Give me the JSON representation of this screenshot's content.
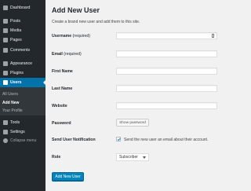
{
  "sidebar": {
    "items": [
      {
        "label": "Dashboard",
        "icon": "dashboard-icon"
      },
      {
        "label": "Posts",
        "icon": "pin-icon"
      },
      {
        "label": "Media",
        "icon": "media-icon"
      },
      {
        "label": "Pages",
        "icon": "page-icon"
      },
      {
        "label": "Comments",
        "icon": "comment-icon"
      },
      {
        "label": "Appearance",
        "icon": "brush-icon"
      },
      {
        "label": "Plugins",
        "icon": "plug-icon"
      },
      {
        "label": "Users",
        "icon": "users-icon"
      },
      {
        "label": "Tools",
        "icon": "wrench-icon"
      },
      {
        "label": "Settings",
        "icon": "settings-icon"
      }
    ],
    "submenu": [
      {
        "label": "All Users"
      },
      {
        "label": "Add New"
      },
      {
        "label": "Your Profile"
      }
    ],
    "collapse_label": "Collapse menu"
  },
  "main": {
    "title": "Add New User",
    "description": "Create a brand new user and add them to this site.",
    "fields": {
      "username": {
        "label": "Username",
        "required": "(required)",
        "value": ""
      },
      "email": {
        "label": "Email",
        "required": "(required)",
        "value": ""
      },
      "first_name": {
        "label": "First Name",
        "value": ""
      },
      "last_name": {
        "label": "Last Name",
        "value": ""
      },
      "website": {
        "label": "Website",
        "value": ""
      },
      "password": {
        "label": "Password",
        "button_label": "Show password"
      },
      "notification": {
        "label": "Send User Notification",
        "checked": true,
        "text": "Send the new user an email about their account."
      },
      "role": {
        "label": "Role",
        "selected": "Subscriber"
      }
    },
    "submit_label": "Add New User"
  },
  "colors": {
    "sidebar_bg": "#23282d",
    "active_bg": "#0073aa",
    "primary_button": "#0085ba",
    "content_bg": "#f1f1f1"
  }
}
